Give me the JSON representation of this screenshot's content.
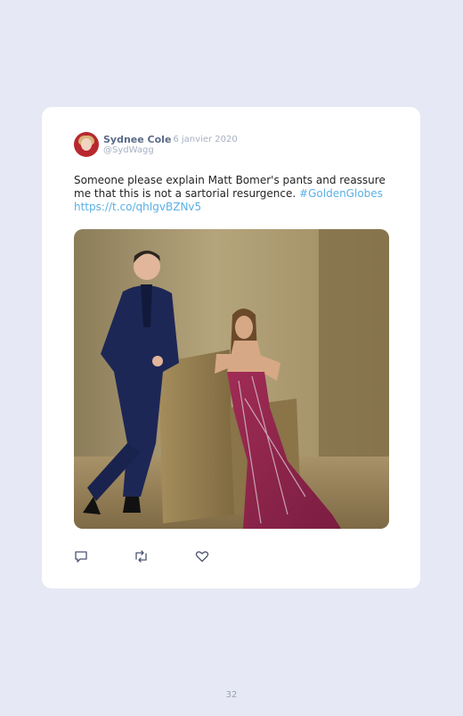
{
  "tweet": {
    "author_name": "Sydnee Cole",
    "date": "· 6 janvier 2020",
    "handle": "@SydWagg",
    "text": "Someone please explain Matt Bomer's pants and reassure me that this is not a sartorial resurgence.",
    "hashtag": "#GoldenGlobes",
    "link": "https://t.co/qhIgvBZNv5"
  },
  "actions": {
    "icons": [
      "reply-icon",
      "retweet-icon",
      "like-icon"
    ]
  },
  "page": {
    "number": "32"
  },
  "colors": {
    "background": "#e6e8f5",
    "card": "#ffffff",
    "link": "#5bb0e6",
    "name": "#5a6a88",
    "meta": "#a7b0c2"
  }
}
